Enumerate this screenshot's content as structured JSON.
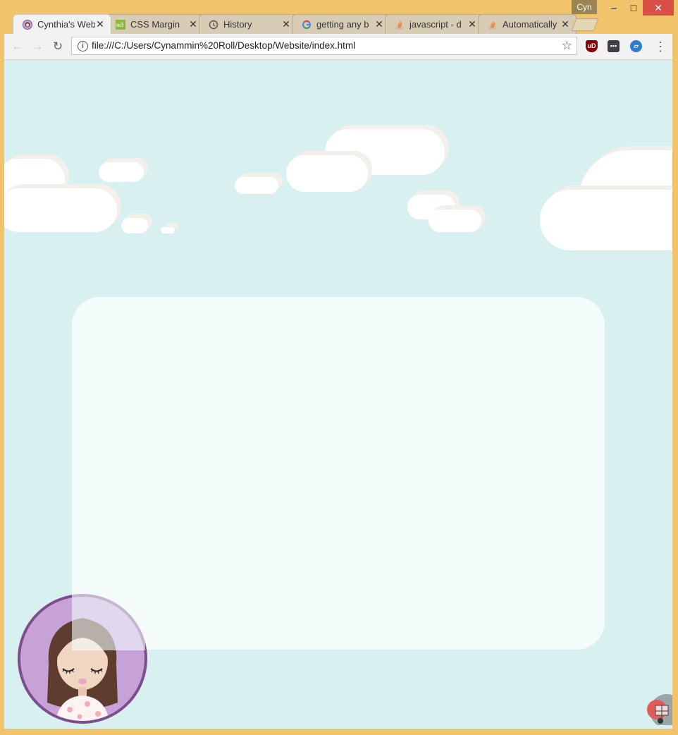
{
  "window": {
    "profile_name": "Cyn",
    "minimize": "–",
    "maximize": "□",
    "close": "✕"
  },
  "tabs": [
    {
      "title": "Cynthia's Website",
      "icon": "avatar-favicon",
      "active": true
    },
    {
      "title": "CSS Margin",
      "icon": "w3-favicon",
      "active": false
    },
    {
      "title": "History",
      "icon": "history-icon",
      "active": false
    },
    {
      "title": "getting any b",
      "icon": "google-g-icon",
      "active": false
    },
    {
      "title": "javascript - d",
      "icon": "stackoverflow-icon",
      "active": false
    },
    {
      "title": "Automatically",
      "icon": "stackoverflow-icon",
      "active": false
    }
  ],
  "tab_close_glyph": "✕",
  "toolbar": {
    "back": "←",
    "forward": "→",
    "reload": "↻",
    "info": "i",
    "url": "file:///C:/Users/Cynammin%20Roll/Desktop/Website/index.html",
    "star": "☆",
    "menu": "⋮",
    "ext_ublock": "uD",
    "ext_dots": "•••",
    "ext_blue": "▱"
  },
  "colors": {
    "page_bg": "#d9f0f1",
    "panel_bg": "#f4fcfb",
    "avatar_bg": "#c6a2d8",
    "avatar_ring": "#7c4e8c",
    "frame": "#f1c46b"
  }
}
